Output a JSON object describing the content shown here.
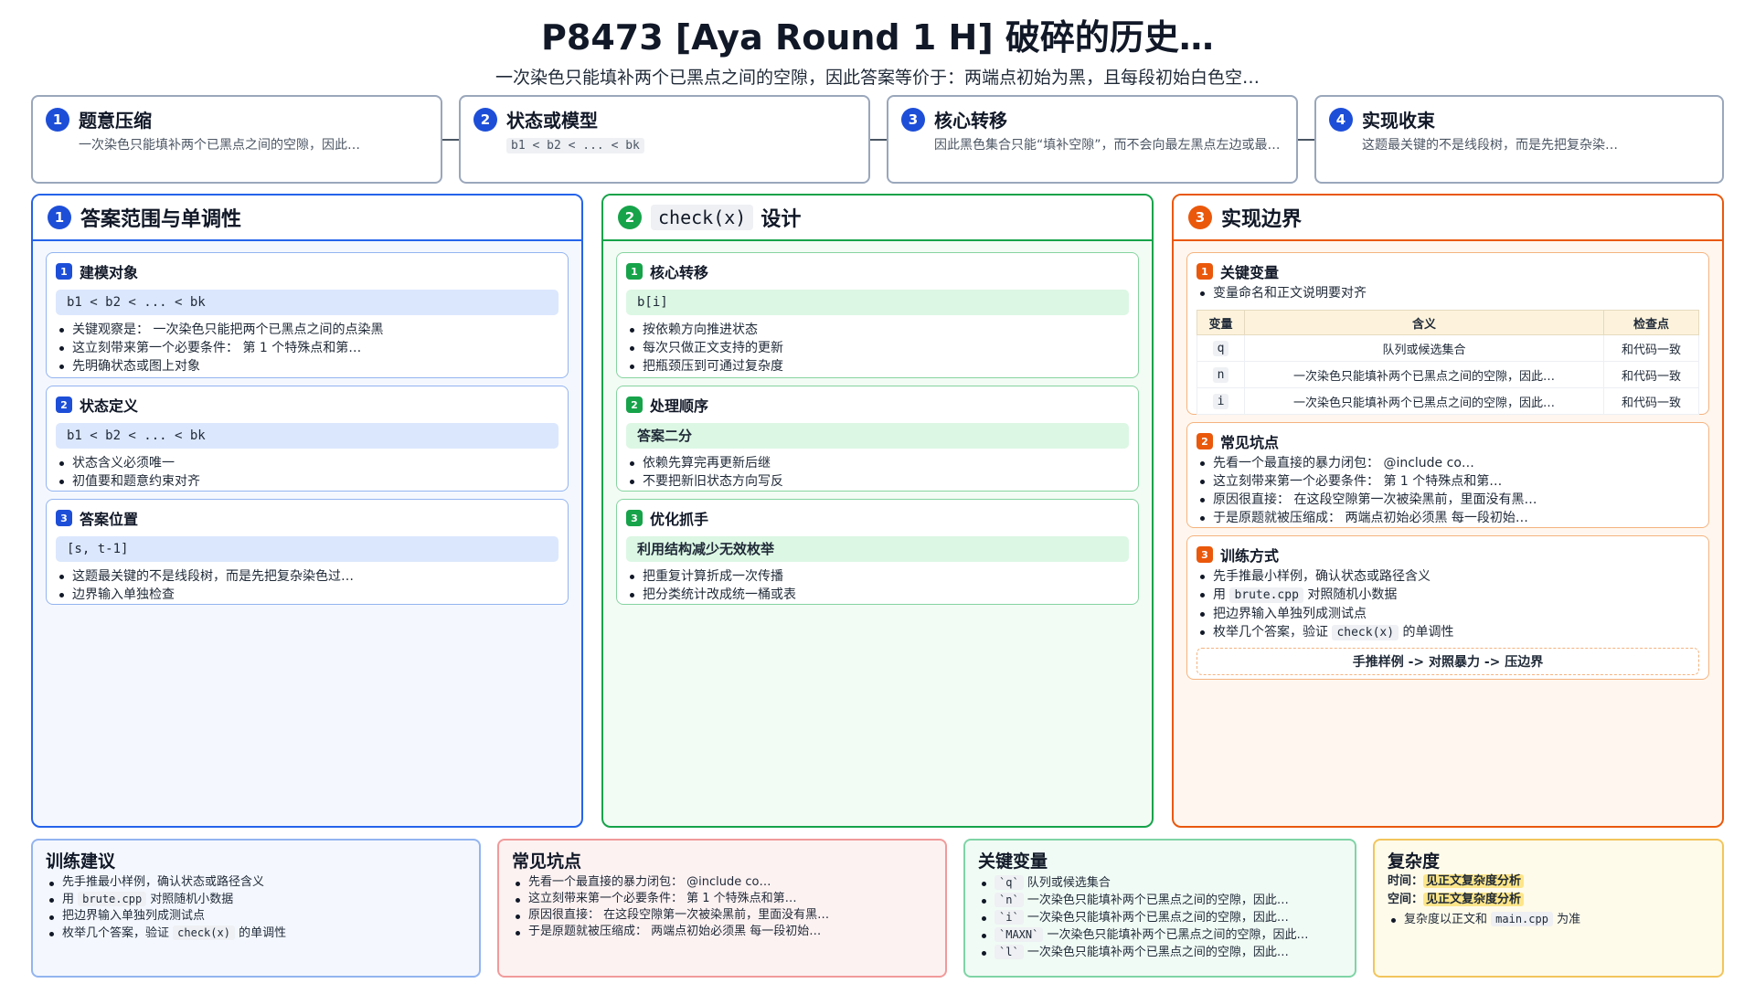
{
  "header": {
    "title": "P8473 [Aya Round 1 H] 破碎的历史…",
    "subtitle": "一次染色只能填补两个已黑点之间的空隙，因此答案等价于：两端点初始为黑，且每段初始白色空…"
  },
  "steps": [
    {
      "num": "1",
      "title": "题意压缩",
      "desc": "一次染色只能填补两个已黑点之间的空隙，因此…"
    },
    {
      "num": "2",
      "title": "状态或模型",
      "code": "b1 < b2 < ... < bk"
    },
    {
      "num": "3",
      "title": "核心转移",
      "desc": "因此黑色集合只能“填补空隙”，而不会向最左黑点左边或最…"
    },
    {
      "num": "4",
      "title": "实现收束",
      "desc": "这题最关键的不是线段树，而是先把复杂染…"
    }
  ],
  "columns": {
    "left": {
      "num": "1",
      "title": "答案范围与单调性",
      "cards": [
        {
          "num": "1",
          "title": "建模对象",
          "code": "b1 < b2 < ... < bk",
          "bullets": [
            "关键观察是： 一次染色只能把两个已黑点之间的点染黑",
            "这立刻带来第一个必要条件： 第 1 个特殊点和第…",
            "先明确状态或图上对象"
          ]
        },
        {
          "num": "2",
          "title": "状态定义",
          "code": "b1 < b2 < ... < bk",
          "bullets": [
            "状态含义必须唯一",
            "初值要和题意约束对齐"
          ]
        },
        {
          "num": "3",
          "title": "答案位置",
          "code": "[s, t-1]",
          "bullets": [
            "这题最关键的不是线段树，而是先把复杂染色过…",
            "边界输入单独检查"
          ]
        }
      ]
    },
    "middle": {
      "num": "2",
      "title_code": "check(x)",
      "title": "设计",
      "cards": [
        {
          "num": "1",
          "title": "核心转移",
          "code": "b[i]",
          "bullets": [
            "按依赖方向推进状态",
            "每次只做正文支持的更新",
            "把瓶颈压到可通过复杂度"
          ]
        },
        {
          "num": "2",
          "title": "处理顺序",
          "code": "答案二分",
          "bullets": [
            "依赖先算完再更新后继",
            "不要把新旧状态方向写反"
          ]
        },
        {
          "num": "3",
          "title": "优化抓手",
          "code": "利用结构减少无效枚举",
          "bullets": [
            "把重复计算折成一次传播",
            "把分类统计改成统一桶或表"
          ]
        }
      ]
    },
    "right": {
      "num": "3",
      "title": "实现边界",
      "vars_card": {
        "num": "1",
        "title": "关键变量",
        "bullet": "变量命名和正文说明要对齐",
        "headers": [
          "变量",
          "含义",
          "检查点"
        ],
        "rows": [
          [
            "q",
            "队列或候选集合",
            "和代码一致"
          ],
          [
            "n",
            "一次染色只能填补两个已黑点之间的空隙，因此…",
            "和代码一致"
          ],
          [
            "i",
            "一次染色只能填补两个已黑点之间的空隙，因此…",
            "和代码一致"
          ]
        ]
      },
      "pitfalls_card": {
        "num": "2",
        "title": "常见坑点",
        "bullets": [
          "先看一个最直接的暴力闭包： @include co…",
          "这立刻带来第一个必要条件： 第 1 个特殊点和第…",
          "原因很直接： 在这段空隙第一次被染黑前，里面没有黑…",
          "于是原题就被压缩成： 两端点初始必须黑 每一段初始…"
        ]
      },
      "training_card": {
        "num": "3",
        "title": "训练方式",
        "b1": "先手推最小样例，确认状态或路径含义",
        "b2_pre": "用 ",
        "b2_code": "brute.cpp",
        "b2_post": " 对照随机小数据",
        "b3": "把边界输入单独列成测试点",
        "b4_pre": "枚举几个答案，验证 ",
        "b4_code": "check(x)",
        "b4_post": " 的单调性",
        "flow": "手推样例 -> 对照暴力 -> 压边界"
      }
    }
  },
  "bottom": {
    "training": {
      "title": "训练建议",
      "b1": "先手推最小样例，确认状态或路径含义",
      "b2_pre": "用 ",
      "b2_code": "brute.cpp",
      "b2_post": " 对照随机小数据",
      "b3": "把边界输入单独列成测试点",
      "b4_pre": "枚举几个答案，验证 ",
      "b4_code": "check(x)",
      "b4_post": " 的单调性"
    },
    "pitfalls": {
      "title": "常见坑点",
      "bullets": [
        "先看一个最直接的暴力闭包： @include co…",
        "这立刻带来第一个必要条件： 第 1 个特殊点和第…",
        "原因很直接： 在这段空隙第一次被染黑前，里面没有黑…",
        "于是原题就被压缩成： 两端点初始必须黑 每一段初始…"
      ]
    },
    "vars": {
      "title": "关键变量",
      "items": [
        {
          "code": "`q`",
          "text": " 队列或候选集合"
        },
        {
          "code": "`n`",
          "text": " 一次染色只能填补两个已黑点之间的空隙，因此…"
        },
        {
          "code": "`i`",
          "text": " 一次染色只能填补两个已黑点之间的空隙，因此…"
        },
        {
          "code": "`MAXN`",
          "text": " 一次染色只能填补两个已黑点之间的空隙，因此…"
        },
        {
          "code": "`l`",
          "text": " 一次染色只能填补两个已黑点之间的空隙，因此…"
        }
      ]
    },
    "complexity": {
      "title": "复杂度",
      "time_label": "时间：",
      "time_value": "见正文复杂度分析",
      "space_label": "空间：",
      "space_value": "见正文复杂度分析",
      "note_pre": "复杂度以正文和 ",
      "note_code": "main.cpp",
      "note_post": " 为准"
    }
  },
  "colors": {
    "blue": "#1d4ed8",
    "green": "#16a34a",
    "orange": "#ea580c"
  }
}
